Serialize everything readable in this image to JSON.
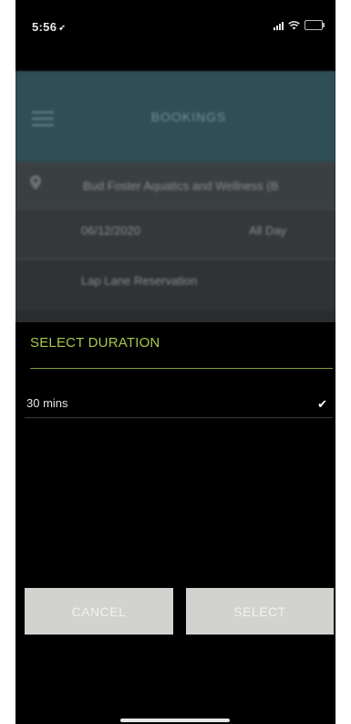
{
  "status_bar": {
    "time": "5:56",
    "location_arrow": "➶"
  },
  "background": {
    "header_title": "BOOKINGS",
    "location": "Bud Foster Aquatics and Wellness (B",
    "date": "06/12/2020",
    "time_range": "All Day",
    "reservation_type": "Lap Lane Reservation"
  },
  "modal": {
    "title": "SELECT DURATION",
    "options": [
      {
        "label": "30 mins",
        "selected": true
      }
    ],
    "check_glyph": "✔",
    "cancel_label": "CANCEL",
    "select_label": "SELECT"
  },
  "colors": {
    "accent_green": "#a8c84a",
    "button_gray": "#d2d2cf",
    "header_teal": "#2f4e56"
  }
}
